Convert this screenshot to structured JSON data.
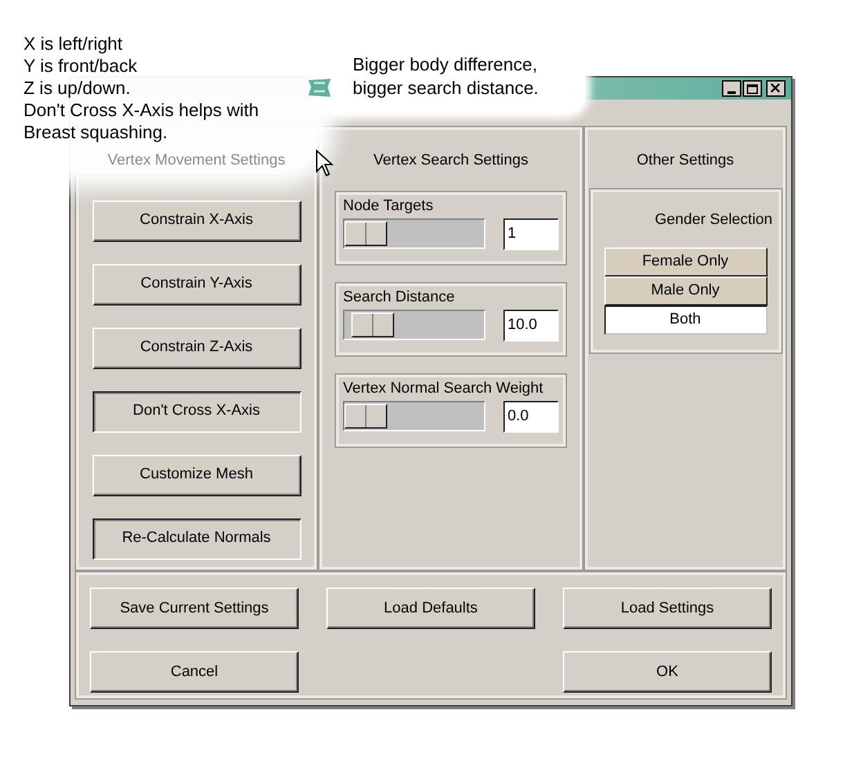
{
  "notes": {
    "axis_help": [
      "X is left/right",
      "Y is front/back",
      "Z is up/down.",
      "Don't Cross X-Axis helps with",
      "Breast squashing."
    ],
    "callout": [
      "Bigger body difference,",
      "bigger search distance."
    ]
  },
  "vertex_movement": {
    "title": "Vertex Movement Settings",
    "buttons": [
      {
        "label": "Constrain X-Axis",
        "pressed": false
      },
      {
        "label": "Constrain Y-Axis",
        "pressed": false
      },
      {
        "label": "Constrain Z-Axis",
        "pressed": false
      },
      {
        "label": "Don't Cross X-Axis",
        "pressed": true
      },
      {
        "label": "Customize Mesh",
        "pressed": false
      },
      {
        "label": "Re-Calculate Normals",
        "pressed": true
      }
    ]
  },
  "vertex_search": {
    "title": "Vertex Search Settings",
    "groups": [
      {
        "label": "Node Targets",
        "level": 0,
        "value": "1"
      },
      {
        "label": "Search Distance",
        "level": 0.07,
        "value": "10.0"
      },
      {
        "label": "Vertex Normal Search Weight",
        "level": 0,
        "value": "0.0"
      }
    ]
  },
  "other_settings": {
    "title": "Other Settings",
    "gender": {
      "title": "Gender Selection",
      "options": [
        {
          "label": "Female Only",
          "selected": false
        },
        {
          "label": "Male Only",
          "selected": false
        },
        {
          "label": "Both",
          "selected": true
        }
      ]
    }
  },
  "footer_buttons": [
    [
      "Save Current Settings",
      "Load Defaults",
      "Load Settings"
    ],
    [
      "Cancel",
      "OK"
    ]
  ]
}
